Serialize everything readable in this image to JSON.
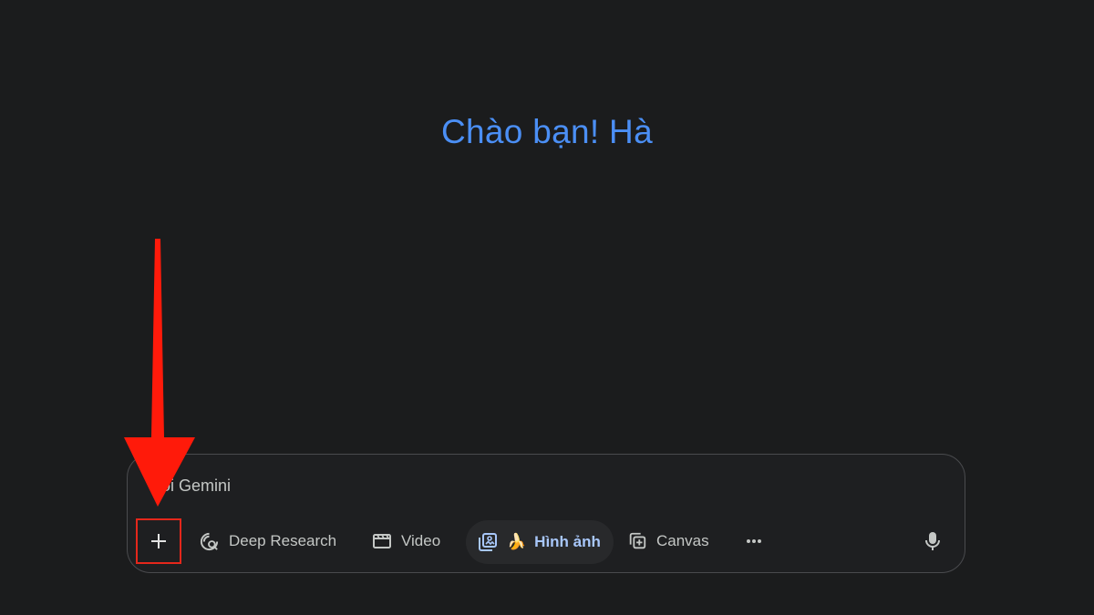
{
  "greeting": "Chào bạn! Hà",
  "composer": {
    "placeholder": "Hỏi Gemini"
  },
  "toolbar": {
    "add_icon": "plus-icon",
    "deep_research": {
      "label": "Deep Research",
      "icon": "deep-research-icon"
    },
    "video": {
      "label": "Video",
      "icon": "clapperboard-icon"
    },
    "image": {
      "label": "Hình ảnh",
      "emoji": "🍌",
      "icon": "image-gallery-icon"
    },
    "canvas": {
      "label": "Canvas",
      "icon": "canvas-icon"
    },
    "more_icon": "more-horizontal-icon",
    "mic_icon": "microphone-icon"
  },
  "colors": {
    "background": "#1b1c1d",
    "greeting": "#4b8ff5",
    "annotation": "#e5271b",
    "active_chip_text": "#a8c7fa"
  }
}
